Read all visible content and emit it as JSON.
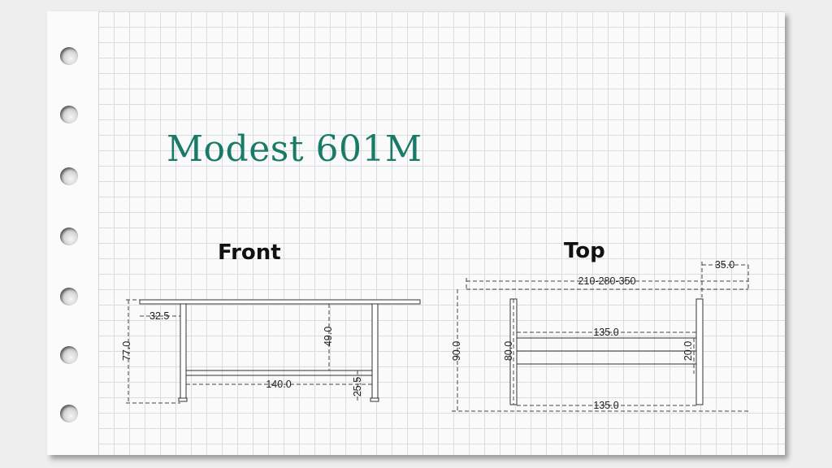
{
  "title": "Modest 601M",
  "views": {
    "front": {
      "label": "Front",
      "dims": {
        "overhang": "32.5",
        "height": "77.0",
        "clearance": "49.0",
        "length": "140.0",
        "foot": "25.5"
      }
    },
    "top": {
      "label": "Top",
      "dims": {
        "extension": "35.0",
        "width_range": "210-280-350",
        "depth": "90.0",
        "inner_depth": "80.0",
        "beam_upper": "135.0",
        "beam_width": "20.0",
        "beam_lower": "135.0"
      }
    }
  }
}
